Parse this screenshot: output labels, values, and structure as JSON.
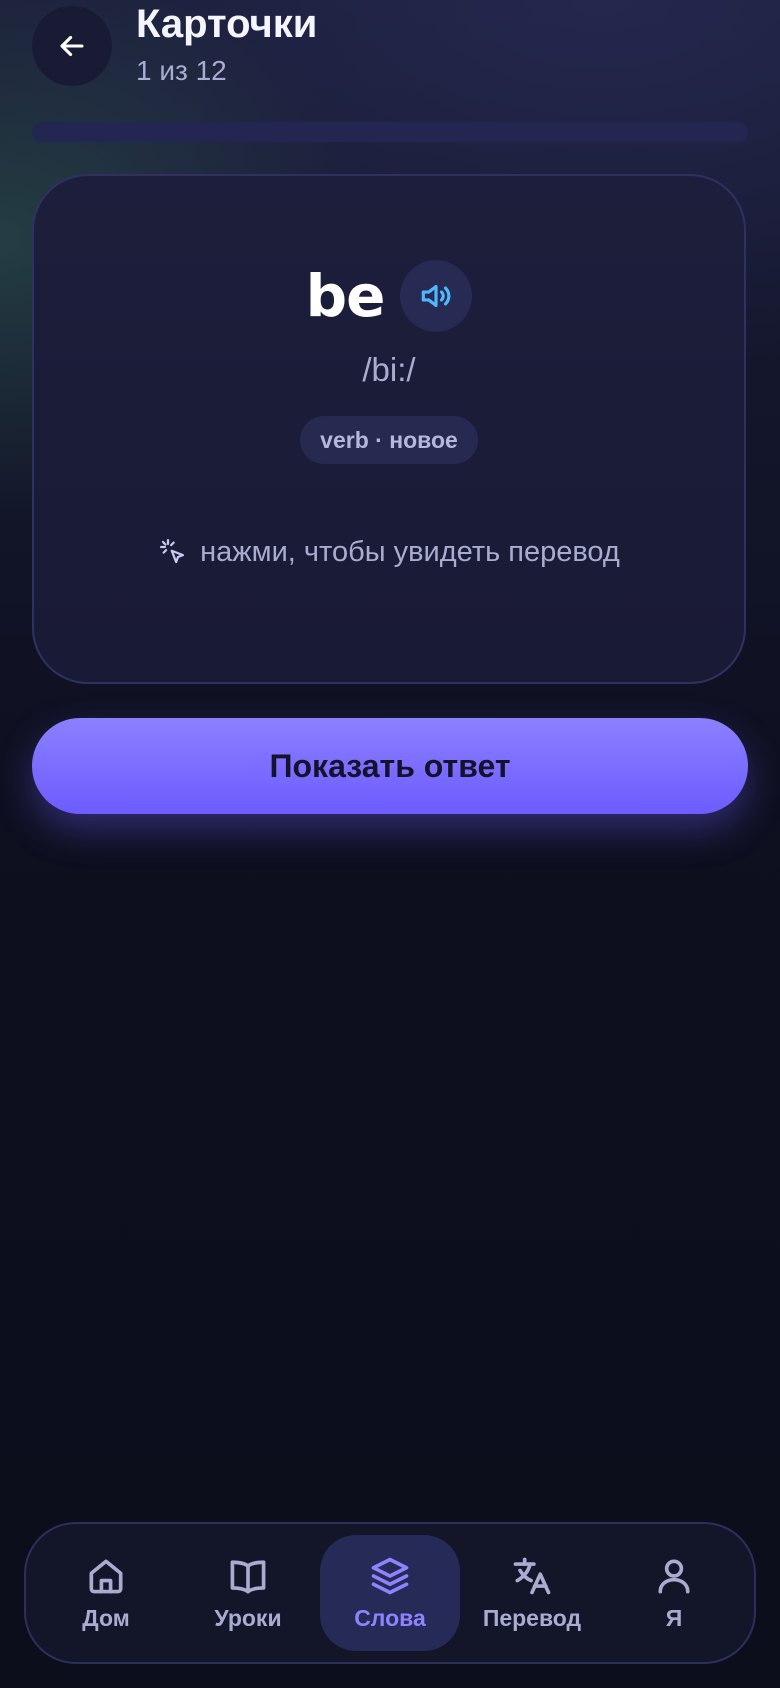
{
  "header": {
    "title": "Карточки",
    "progress_text": "1 из 12",
    "back_icon": "arrow-left-icon"
  },
  "progress": {
    "current": 1,
    "total": 12,
    "fill_fraction": 0
  },
  "card": {
    "word": "be",
    "transcription": "/bi:/",
    "tag": "verb · новое",
    "hint": "нажми, чтобы увидеть перевод",
    "speaker_icon": "speaker-icon",
    "hint_icon": "tap-cursor-icon"
  },
  "actions": {
    "show_answer": "Показать ответ"
  },
  "nav": {
    "items": [
      {
        "label": "Дом",
        "icon": "home-icon",
        "active": false
      },
      {
        "label": "Уроки",
        "icon": "book-icon",
        "active": false
      },
      {
        "label": "Слова",
        "icon": "layers-icon",
        "active": true
      },
      {
        "label": "Перевод",
        "icon": "translate-icon",
        "active": false
      },
      {
        "label": "Я",
        "icon": "user-icon",
        "active": false
      }
    ]
  },
  "colors": {
    "accent": "#7c6cff",
    "accent_light": "#8f82ff",
    "speaker": "#4fb8ff",
    "background": "#0d0f1e",
    "card": "#1c1e3b"
  }
}
